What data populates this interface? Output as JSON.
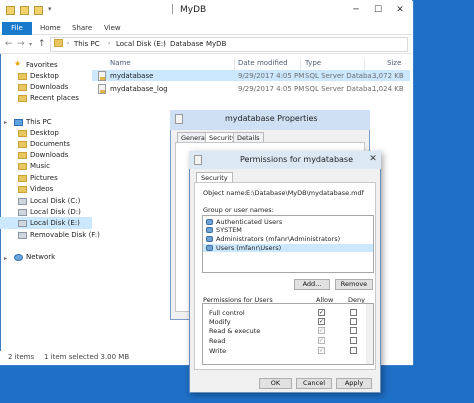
{
  "explorer": {
    "title": "MyDB",
    "ribbon_tabs": [
      "File",
      "Home",
      "Share",
      "View"
    ],
    "breadcrumb": [
      "This PC",
      "Local Disk (E:)",
      "Database",
      "MyDB"
    ],
    "nav": {
      "favorites": "Favorites",
      "fav_items": [
        "Desktop",
        "Downloads",
        "Recent places"
      ],
      "this_pc": "This PC",
      "pc_items": [
        "Desktop",
        "Documents",
        "Downloads",
        "Music",
        "Pictures",
        "Videos",
        "Local Disk (C:)",
        "Local Disk (D:)",
        "Local Disk (E:)",
        "Removable Disk (F:)"
      ],
      "network": "Network"
    },
    "columns": [
      "Name",
      "Date modified",
      "Type",
      "Size"
    ],
    "files": [
      {
        "name": "mydatabase",
        "date": "9/29/2017 4:05 PM",
        "type": "SQL Server Databa...",
        "size": "3,072 KB"
      },
      {
        "name": "mydatabase_log",
        "date": "9/29/2017 4:05 PM",
        "type": "SQL Server Databa...",
        "size": "1,024 KB"
      }
    ],
    "status": {
      "items": "2 items",
      "selected": "1 item selected  3.00 MB"
    }
  },
  "props": {
    "title": "mydatabase Properties",
    "tabs": [
      "General",
      "Security",
      "Details"
    ]
  },
  "perm": {
    "title": "Permissions for mydatabase",
    "tab": "Security",
    "object_label": "Object name:",
    "object_value": "E:\\Database\\MyDB\\mydatabase.mdf",
    "groups_label": "Group or user names:",
    "groups": [
      "Authenticated Users",
      "SYSTEM",
      "Administrators (mfanr\\Administrators)",
      "Users (mfanr\\Users)"
    ],
    "add": "Add...",
    "remove": "Remove",
    "perm_for": "Permissions for Users",
    "allow": "Allow",
    "deny": "Deny",
    "permissions": [
      {
        "name": "Full control",
        "allow": true,
        "deny": false
      },
      {
        "name": "Modify",
        "allow": true,
        "deny": false
      },
      {
        "name": "Read & execute",
        "allow": true,
        "deny": false
      },
      {
        "name": "Read",
        "allow": true,
        "deny": false
      },
      {
        "name": "Write",
        "allow": true,
        "deny": false
      }
    ],
    "ok": "OK",
    "cancel": "Cancel",
    "apply": "Apply"
  }
}
